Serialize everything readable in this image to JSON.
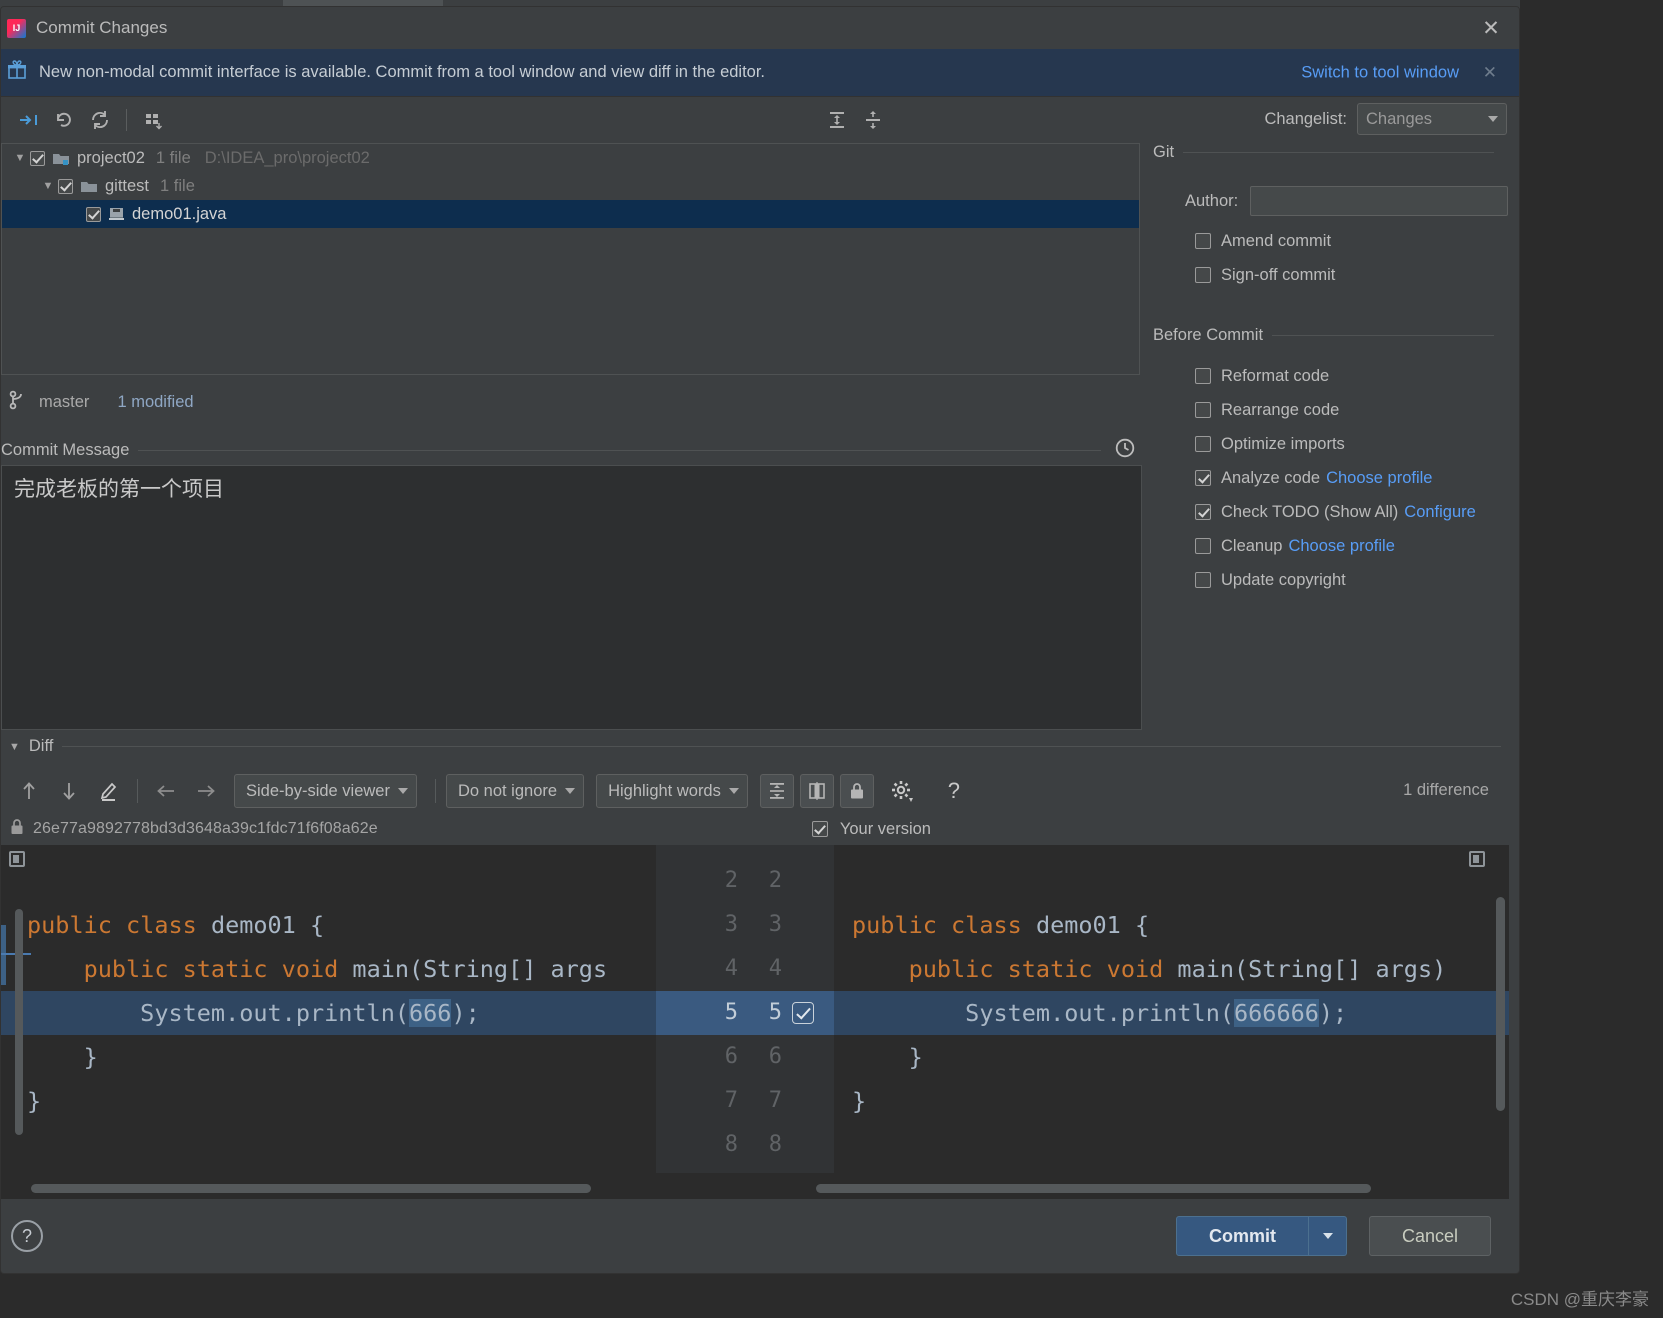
{
  "window": {
    "title": "Commit Changes",
    "close_label": "✕",
    "app_icon": "intellij-idea-logo"
  },
  "banner": {
    "text": "New non-modal commit interface is available. Commit from a tool window and view diff in the editor.",
    "link": "Switch to tool window",
    "close_label": "✕",
    "icon": "gift-icon",
    "bg": "#26374f"
  },
  "toolbar": {
    "icons": [
      "collapse-expand-icon",
      "revert-icon",
      "refresh-icon",
      "group-by-icon"
    ],
    "changelist_label": "Changelist:",
    "changelist_value": "Changes"
  },
  "tree": {
    "rows": [
      {
        "name": "project02",
        "meta": "1 file",
        "path": "D:\\IDEA_pro\\project02",
        "type": "module-folder",
        "checked": true,
        "expanded": true,
        "depth": 0,
        "selected": false
      },
      {
        "name": "gittest",
        "meta": "1 file",
        "path": "",
        "type": "folder",
        "checked": true,
        "expanded": true,
        "depth": 1,
        "selected": false
      },
      {
        "name": "demo01.java",
        "meta": "",
        "path": "",
        "type": "java-file",
        "checked": true,
        "expanded": null,
        "depth": 2,
        "selected": true
      }
    ]
  },
  "branch": {
    "icon": "git-branch-icon",
    "name": "master",
    "status": "1 modified"
  },
  "commit_message": {
    "title": "Commit Message",
    "value": "完成老板的第一个项目",
    "history_icon": "clock-icon"
  },
  "git_panel": {
    "section_title": "Git",
    "author_label": "Author:",
    "author_value": "",
    "options": [
      {
        "label": "Amend commit",
        "checked": false
      },
      {
        "label": "Sign-off commit",
        "checked": false
      }
    ]
  },
  "before_commit": {
    "section_title": "Before Commit",
    "options": [
      {
        "label": "Reformat code",
        "checked": false,
        "link": ""
      },
      {
        "label": "Rearrange code",
        "checked": false,
        "link": ""
      },
      {
        "label": "Optimize imports",
        "checked": false,
        "link": ""
      },
      {
        "label": "Analyze code",
        "checked": true,
        "link": "Choose profile"
      },
      {
        "label": "Check TODO (Show All)",
        "checked": true,
        "link": "Configure"
      },
      {
        "label": "Cleanup",
        "checked": false,
        "link": "Choose profile"
      },
      {
        "label": "Update copyright",
        "checked": false,
        "link": ""
      }
    ]
  },
  "diff": {
    "section_title": "Diff",
    "toolbar": {
      "prev_icon": "arrow-up-icon",
      "next_icon": "arrow-down-icon",
      "edit_icon": "pencil-icon",
      "left_icon": "arrow-left-icon",
      "right_icon": "arrow-right-icon",
      "viewer_mode": "Side-by-side viewer",
      "whitespace": "Do not ignore",
      "highlight": "Highlight words",
      "collapse_icon": "collapse-unchanged-icon",
      "columns_icon": "compare-columns-icon",
      "lock_icon": "lock-icon",
      "settings_icon": "gear-icon",
      "help_icon": "question-icon"
    },
    "difference_count": "1 difference",
    "revision_hash": "26e77a9892778bd3d3648a39c1fdc71f6f08a62e",
    "revision_lock_icon": "lock-icon",
    "your_version_label": "Your version",
    "your_version_checked": true,
    "line_numbers_left": [
      "2",
      "3",
      "4",
      "5",
      "6",
      "7",
      "8"
    ],
    "line_numbers_right": [
      "2",
      "3",
      "4",
      "5",
      "6",
      "7",
      "8"
    ],
    "diff_line_index": 3,
    "left_code": [
      {
        "text": "",
        "parts": []
      },
      {
        "text": "public class demo01 {",
        "parts": [
          {
            "t": "public class ",
            "c": "kw"
          },
          {
            "t": "demo01 {",
            "c": ""
          }
        ]
      },
      {
        "text": "    public static void main(String[] args",
        "parts": [
          {
            "t": "    ",
            "c": ""
          },
          {
            "t": "public static void ",
            "c": "kw"
          },
          {
            "t": "main(String[] args",
            "c": ""
          }
        ]
      },
      {
        "text": "        System.out.println(666);",
        "parts": [
          {
            "t": "        System.out.println(",
            "c": ""
          },
          {
            "t": "666",
            "c": "num-hl"
          },
          {
            "t": ");",
            "c": ""
          }
        ]
      },
      {
        "text": "    }",
        "parts": [
          {
            "t": "    }",
            "c": ""
          }
        ]
      },
      {
        "text": "}",
        "parts": [
          {
            "t": "}",
            "c": ""
          }
        ]
      },
      {
        "text": "",
        "parts": []
      }
    ],
    "right_code": [
      {
        "text": "",
        "parts": []
      },
      {
        "text": "public class demo01 {",
        "parts": [
          {
            "t": "public class ",
            "c": "kw"
          },
          {
            "t": "demo01 {",
            "c": ""
          }
        ]
      },
      {
        "text": "    public static void main(String[] args)",
        "parts": [
          {
            "t": "    ",
            "c": ""
          },
          {
            "t": "public static void ",
            "c": "kw"
          },
          {
            "t": "main(String[] args)",
            "c": ""
          }
        ]
      },
      {
        "text": "        System.out.println(666666);",
        "parts": [
          {
            "t": "        System.out.println(",
            "c": ""
          },
          {
            "t": "666666",
            "c": "num-hl"
          },
          {
            "t": ");",
            "c": ""
          }
        ]
      },
      {
        "text": "    }",
        "parts": [
          {
            "t": "    }",
            "c": ""
          }
        ]
      },
      {
        "text": "}",
        "parts": [
          {
            "t": "}",
            "c": ""
          }
        ]
      },
      {
        "text": "",
        "parts": []
      }
    ]
  },
  "buttons": {
    "help": "?",
    "commit": "Commit",
    "commit_dropdown": "▾",
    "cancel": "Cancel"
  },
  "watermark": "CSDN @重庆李豪",
  "colors": {
    "accent": "#589df6",
    "selection": "#0d2d4e",
    "diff_highlight": "#3d6185",
    "button_primary": "#365880",
    "keyword": "#cc7832"
  }
}
